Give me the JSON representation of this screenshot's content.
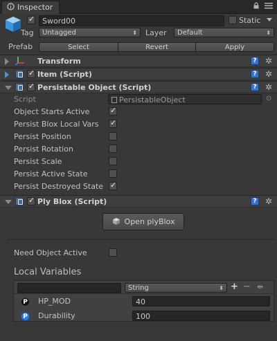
{
  "window": {
    "tab_label": "Inspector",
    "lock_glyph": "🔒",
    "menu_glyph": "≡"
  },
  "gameobject": {
    "name": "Sword00",
    "static_label": "Static",
    "tag_label": "Tag",
    "tag_value": "Untagged",
    "layer_label": "Layer",
    "layer_value": "Default",
    "prefab_label": "Prefab",
    "prefab_buttons": [
      "Select",
      "Revert",
      "Apply"
    ]
  },
  "components": {
    "transform": {
      "title": "Transform"
    },
    "item": {
      "title": "Item (Script)"
    },
    "persistable": {
      "title": "Persistable Object (Script)",
      "script_label": "Script",
      "script_value": "PersistableObject",
      "properties": [
        {
          "label": "Object Starts Active",
          "checked": true
        },
        {
          "label": "Persist Blox Local Vars",
          "checked": true
        },
        {
          "label": "Persist Position",
          "checked": false
        },
        {
          "label": "Persist Rotation",
          "checked": false
        },
        {
          "label": "Persist Scale",
          "checked": false
        },
        {
          "label": "Persist Active State",
          "checked": false
        },
        {
          "label": "Persist Destroyed State",
          "checked": true
        }
      ]
    },
    "plyblox": {
      "title": "Ply Blox (Script)",
      "open_button": "Open plyBlox",
      "need_active_label": "Need Object Active",
      "need_active_checked": false,
      "local_vars_label": "Local Variables",
      "type_value": "String",
      "variables": [
        {
          "badge": "P",
          "name": "HP_MOD",
          "value": "40",
          "badge_color": "#111111"
        },
        {
          "badge": "P",
          "name": "Durability",
          "value": "100",
          "badge_color": "#2a7de1"
        }
      ]
    }
  },
  "colors": {
    "help_blue": "#3a72c8",
    "panel_bg": "#383838"
  }
}
